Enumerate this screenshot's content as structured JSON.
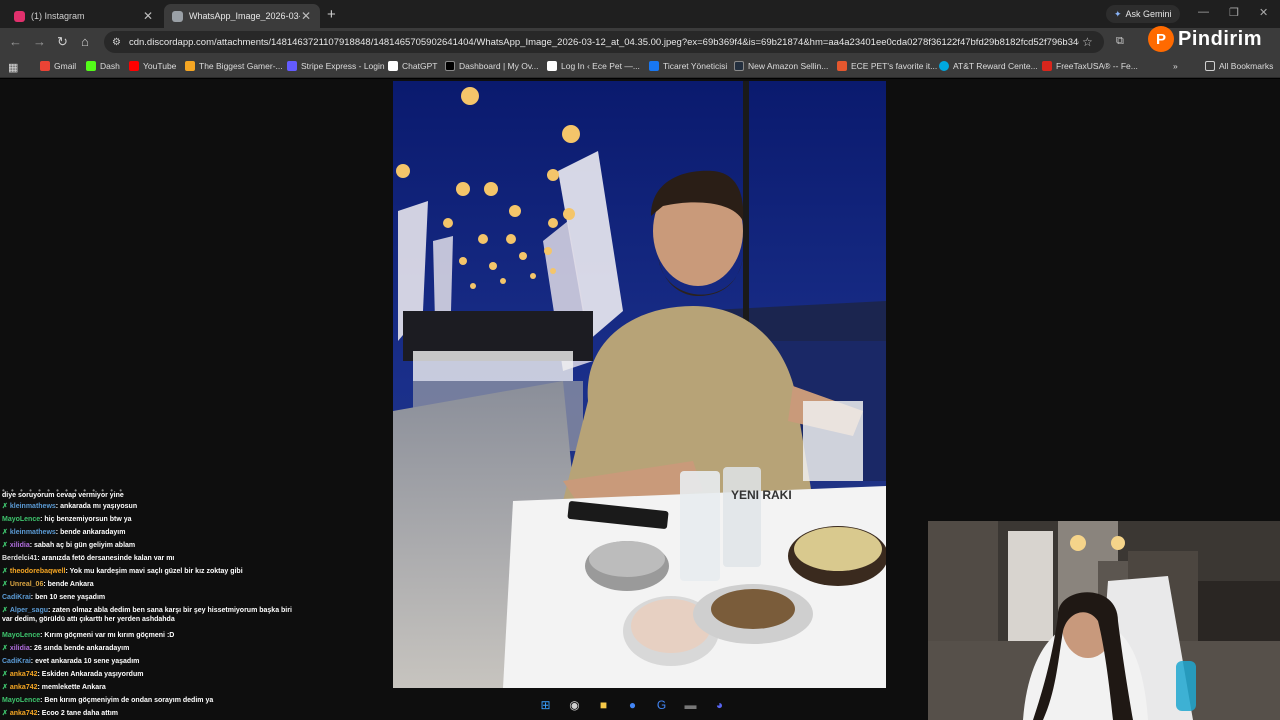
{
  "tabs": [
    {
      "title": "(1) Instagram",
      "icon": "instagram-icon",
      "color": "#e1306c"
    },
    {
      "title": "WhatsApp_Image_2026-03-12_",
      "icon": "image-icon",
      "color": "#9aa0a6"
    }
  ],
  "toolbar": {
    "gemini_label": "Ask Gemini",
    "url": "cdn.discordapp.com/attachments/1481463721107918848/1481465705902641404/WhatsApp_Image_2026-03-12_at_04.35.00.jpeg?ex=69b369f4&is=69b21874&hm=aa4a23401ee0cda0278f36122f47bfd29b8182fcd52f796b34c4b..."
  },
  "extension": {
    "logo": "P",
    "name": "Pindirim",
    "color": "#ff6a00"
  },
  "bookmarks": [
    {
      "label": "Gmail",
      "color": "#ea4335"
    },
    {
      "label": "Dash",
      "color": "#53fc18"
    },
    {
      "label": "YouTube",
      "color": "#ff0000"
    },
    {
      "label": "The Biggest Gamer-...",
      "color": "#f5a623"
    },
    {
      "label": "Stripe Express - Login",
      "color": "#635bff"
    },
    {
      "label": "ChatGPT",
      "color": "#ffffff"
    },
    {
      "label": "Dashboard | My Ov...",
      "color": "#000000"
    },
    {
      "label": "Log In ‹ Ece Pet —...",
      "color": "#ffffff"
    },
    {
      "label": "Ticaret Yöneticisi",
      "color": "#1877f2"
    },
    {
      "label": "New Amazon Sellin...",
      "color": "#232f3e"
    },
    {
      "label": "ECE PET's favorite it...",
      "color": "#e4572e"
    },
    {
      "label": "AT&T Reward Cente...",
      "color": "#00a8e0"
    },
    {
      "label": "FreeTaxUSA® -- Fe...",
      "color": "#d9261c"
    }
  ],
  "all_bookmarks_label": "All Bookmarks",
  "chat": {
    "top_line": "diye soruyorum cevap vermiyor yine",
    "messages": [
      {
        "user": "kleinmathews",
        "text": ": ankarada mı yaşıyosun",
        "color": "#5b9bd5",
        "badge": true
      },
      {
        "user": "MayoLence",
        "text": ": hiç benzemiyorsun btw ya",
        "color": "#3ec46d",
        "badge": false
      },
      {
        "user": "kleinmathews",
        "text": ": bende ankaradayım",
        "color": "#5b9bd5",
        "badge": true
      },
      {
        "user": "xilidia",
        "text": ": sabah aç bi gün geliyim ablam",
        "color": "#b26ee0",
        "badge": true
      },
      {
        "user": "Berdelci41",
        "text": ": aranızda fetö dersanesinde kalan var mı",
        "color": "#e0e0e0",
        "badge": false
      },
      {
        "user": "theodorebaqwell",
        "text": ": Yok mu kardeşim mavi saçlı güzel bir kız zoktay gibi",
        "color": "#f5a623",
        "badge": true
      },
      {
        "user": "Unreal_06",
        "text": ": bende Ankara",
        "color": "#d9a441",
        "badge": true
      },
      {
        "user": "CadiKrai",
        "text": ": ben 10 sene yaşadım",
        "color": "#5b9bd5",
        "badge": false
      },
      {
        "user": "Alper_sagu",
        "text": ": zaten olmaz abla dedim ben sana karşı bir şey hissetmiyorum başka biri var dedim, görüldü attı çıkarttı her yerden ashdahda",
        "color": "#5b9bd5",
        "badge": true
      },
      {
        "user": "MayoLence",
        "text": ": Kırım göçmeni var mı kırım göçmeni :D",
        "color": "#3ec46d",
        "badge": false
      },
      {
        "user": "xilidia",
        "text": ": 26 sında bende ankaradayım",
        "color": "#b26ee0",
        "badge": true
      },
      {
        "user": "CadiKrai",
        "text": ": evet ankarada 10 sene yaşadım",
        "color": "#5b9bd5",
        "badge": false
      },
      {
        "user": "anka742",
        "text": ": Eskiden Ankarada yaşıyordum",
        "color": "#f5a623",
        "badge": true
      },
      {
        "user": "anka742",
        "text": ": memlekette Ankara",
        "color": "#f5a623",
        "badge": true
      },
      {
        "user": "MayoLence",
        "text": ": Ben kırım göçmeniyim de ondan sorayım dedim ya",
        "color": "#3ec46d",
        "badge": false
      },
      {
        "user": "anka742",
        "text": ": Ecoo 2 tane daha attım",
        "color": "#f5a623",
        "badge": true
      }
    ]
  },
  "photo_text": {
    "bottle_label": "YENI RAKI"
  },
  "taskbar": [
    {
      "icon": "windows-start-icon",
      "glyph": "⊞",
      "color": "#3aa0ff"
    },
    {
      "icon": "obs-icon",
      "glyph": "◉",
      "color": "#cfcfcf"
    },
    {
      "icon": "file-explorer-icon",
      "glyph": "■",
      "color": "#f7c948"
    },
    {
      "icon": "chrome-icon",
      "glyph": "●",
      "color": "#4285f4"
    },
    {
      "icon": "google-icon",
      "glyph": "G",
      "color": "#4285f4"
    },
    {
      "icon": "app-icon",
      "glyph": "▬",
      "color": "#777777"
    },
    {
      "icon": "discord-icon",
      "glyph": "◕",
      "color": "#5865f2"
    }
  ]
}
